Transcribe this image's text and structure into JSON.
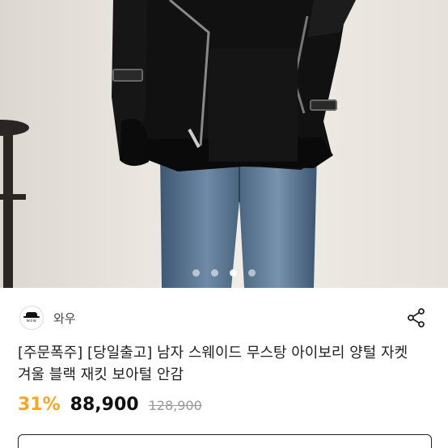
{
  "product": {
    "image": {
      "alt": "black suede mustang jacket with fur trim",
      "slides": 4,
      "active_slide": 2
    },
    "seller": {
      "logo_text": "wow",
      "name": "와우"
    },
    "title": "[주문폭주] [당일출고] 남자 스웨이드 무스탕 아이보리 양털 자켓 겨울 블랙 재킷 보아털 안감",
    "discount": "31%",
    "price": "88,900",
    "original_price": "128,900"
  },
  "colors": {
    "discount": "#f5a623",
    "price": "#111111",
    "original_price": "#999999"
  },
  "icons": {
    "share": "share-icon"
  }
}
